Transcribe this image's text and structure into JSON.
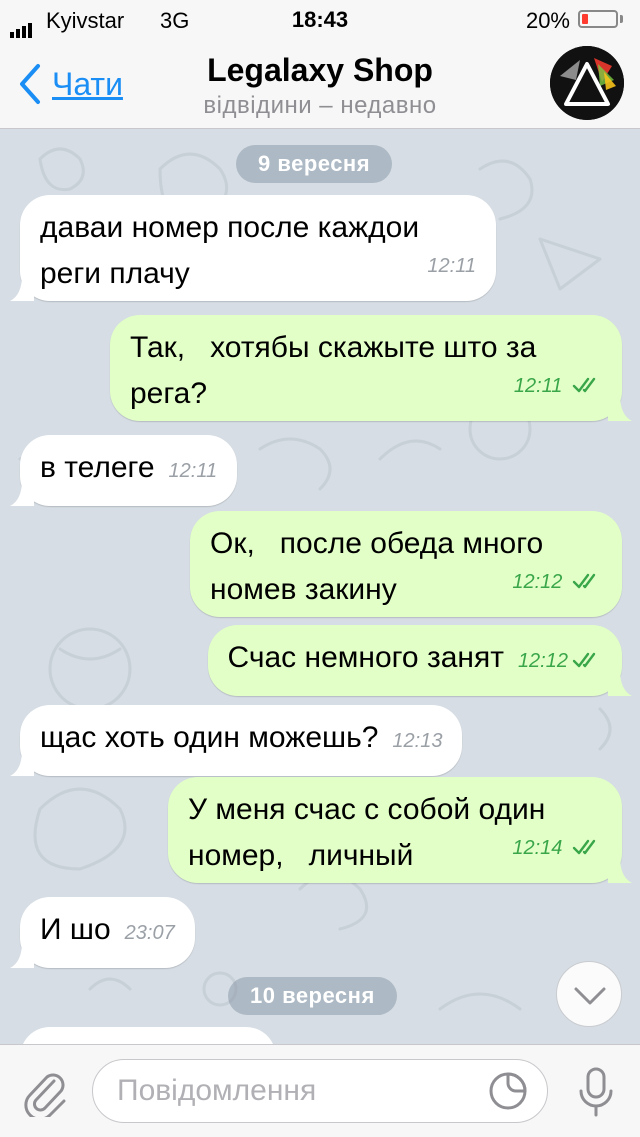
{
  "status_bar": {
    "carrier": "Kyivstar",
    "network": "3G",
    "time": "18:43",
    "battery_percent_label": "20%",
    "battery_level": 0.2
  },
  "header": {
    "back_label": "Чати",
    "title": "Legalaxy Shop",
    "subtitle": "відвідини – недавно",
    "back_icon": "chevron-left-icon",
    "avatar_icon": "triangle-logo-icon"
  },
  "chat": {
    "date_dividers": [
      {
        "label": "9 вересня"
      },
      {
        "label": "10 вересня"
      }
    ],
    "messages": [
      {
        "direction": "incoming",
        "text": "даваи номер после каждои\nреги плачу",
        "time": "12:11"
      },
      {
        "direction": "outgoing",
        "text": "Так,   хотябы скажыте што за\nрега?",
        "time": "12:11",
        "read": true
      },
      {
        "direction": "incoming",
        "text": "в телеге",
        "time": "12:11"
      },
      {
        "direction": "outgoing",
        "text": "Ок,   после обеда много\nномев закину",
        "time": "12:12",
        "read": true
      },
      {
        "direction": "outgoing",
        "text": "Счас немного занят",
        "time": "12:12",
        "read": true
      },
      {
        "direction": "incoming",
        "text": "щас хоть один можешь?",
        "time": "12:13"
      },
      {
        "direction": "outgoing",
        "text": "У меня счас с собой один\nномер,   личный",
        "time": "12:14",
        "read": true
      },
      {
        "direction": "incoming",
        "text": "И шо",
        "time": "23:07"
      }
    ]
  },
  "input_bar": {
    "placeholder": "Повідомлення",
    "attach_icon": "paperclip-icon",
    "sticker_icon": "sticker-icon",
    "mic_icon": "microphone-icon"
  },
  "scroll_down_icon": "chevron-down-icon",
  "colors": {
    "accent": "#1a8ef5",
    "outgoing_bubble": "#e2ffc7",
    "incoming_bubble": "#ffffff",
    "read_check": "#3aa64a",
    "battery_low": "#ff3b30"
  }
}
